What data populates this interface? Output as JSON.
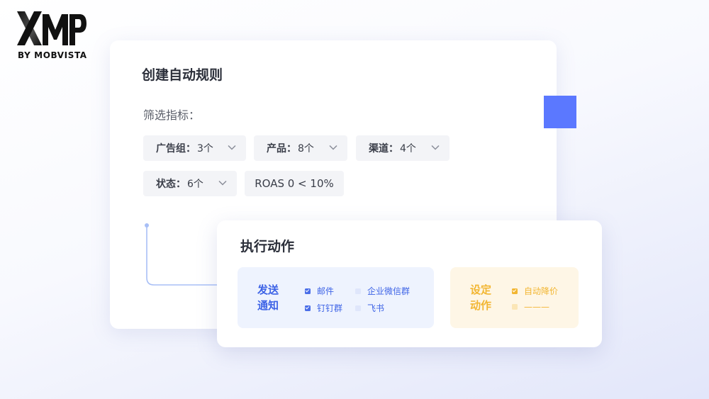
{
  "brand": {
    "logo_wordmark": "XMP",
    "logo_sub": "BY MOBVISTA"
  },
  "rule_card": {
    "title": "创建自动规则",
    "filter_label": "筛选指标：",
    "chips": [
      {
        "key": "广告组：",
        "value": "3个",
        "icon": "chevron-down-icon"
      },
      {
        "key": "产品：",
        "value": "8个",
        "icon": "chevron-down-icon"
      },
      {
        "key": "渠道：",
        "value": "4个",
        "icon": "chevron-down-icon"
      },
      {
        "key": "状态：",
        "value": "6个",
        "icon": "chevron-down-icon"
      },
      {
        "text": "ROAS 0 < 10%"
      }
    ]
  },
  "action_card": {
    "title": "执行动作",
    "notify": {
      "heading_line1": "发送",
      "heading_line2": "通知",
      "options": [
        {
          "label": "邮件",
          "checked": true
        },
        {
          "label": "企业微信群",
          "checked": false
        },
        {
          "label": "钉钉群",
          "checked": true
        },
        {
          "label": "飞书",
          "checked": false
        }
      ]
    },
    "set_action": {
      "heading_line1": "设定",
      "heading_line2": "动作",
      "options": [
        {
          "label": "自动降价",
          "checked": true
        },
        {
          "label": "———",
          "checked": false
        }
      ]
    }
  },
  "colors": {
    "accent_blue": "#5b78ff",
    "notify_bg": "#eef3fe",
    "notify_text": "#3d63e6",
    "notify_check": "#4a6ee8",
    "notify_unchecked": "#dfe6fb",
    "action_bg": "#fef6e6",
    "action_text": "#f2b632",
    "action_check": "#f2b632",
    "action_unchecked": "#fbe6b6",
    "connector": "#a8bff6"
  }
}
